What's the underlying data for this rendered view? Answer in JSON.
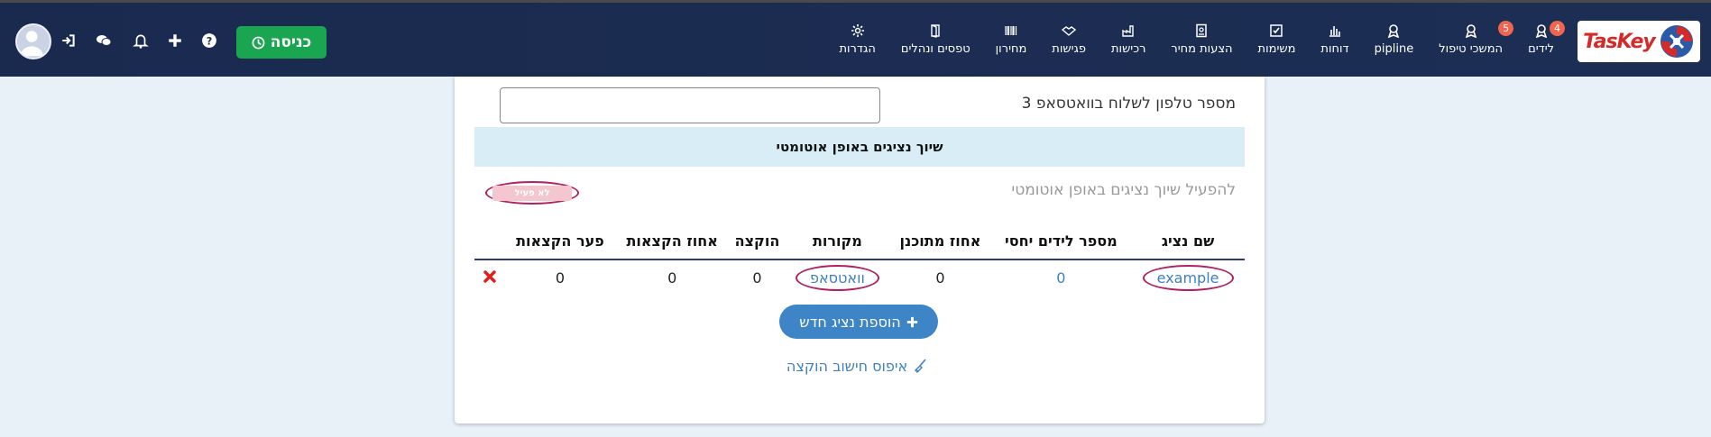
{
  "brand": {
    "logo_text": "TasKey",
    "colors": {
      "navbar": "#1a2a4f",
      "enter_button": "#1aa550",
      "accent_link": "#3e80be",
      "highlight_circle": "#b0225f",
      "section_bg": "#d9edf7",
      "badge": "#f0654f"
    }
  },
  "nav": {
    "items": [
      {
        "label": "לידים",
        "icon": "award-icon",
        "badge": "4"
      },
      {
        "label": "המשכי טיפול",
        "icon": "award-icon",
        "badge": "5"
      },
      {
        "label": "pipline",
        "icon": "award-icon"
      },
      {
        "label": "דוחות",
        "icon": "bar-chart-icon"
      },
      {
        "label": "משימות",
        "icon": "checkbox-icon"
      },
      {
        "label": "הצעות מחיר",
        "icon": "document-icon"
      },
      {
        "label": "רכישות",
        "icon": "factory-icon"
      },
      {
        "label": "פגישות",
        "icon": "handshake-icon"
      },
      {
        "label": "מחירון",
        "icon": "barcode-icon"
      },
      {
        "label": "טפסים ונהלים",
        "icon": "door-icon"
      },
      {
        "label": "הגדרות",
        "icon": "gear-icon"
      }
    ]
  },
  "toolbar": {
    "enter_label": "כניסה",
    "icons": [
      "help-icon",
      "plus-icon",
      "bell-icon",
      "chat-icon",
      "sign-in-icon",
      "avatar"
    ]
  },
  "form": {
    "phone_label": "מספר טלפון לשלוח בוואטסאפ 3",
    "phone_value": ""
  },
  "auto_assign": {
    "section_title": "שיוך נציגים באופן אוטומטי",
    "toggle_label": "להפעיל שיוך נציגים באופן אוטומטי",
    "toggle_state": "לא פעיל"
  },
  "table": {
    "headers": [
      "שם נציג",
      "מספר לידים יחסי",
      "אחוז מתוכנן",
      "מקורות",
      "הוקצה",
      "אחוז הקצאות",
      "פער הקצאות"
    ],
    "rows": [
      {
        "name": "example",
        "relative_leads": "0",
        "planned_percent": "0",
        "sources": "וואטסאפ",
        "allocated": "0",
        "allocation_percent": "0",
        "allocation_gap": "0"
      }
    ]
  },
  "actions": {
    "add_rep_label": "הוספת נציג חדש",
    "reset_label": "איפוס חישוב הוקצה"
  }
}
